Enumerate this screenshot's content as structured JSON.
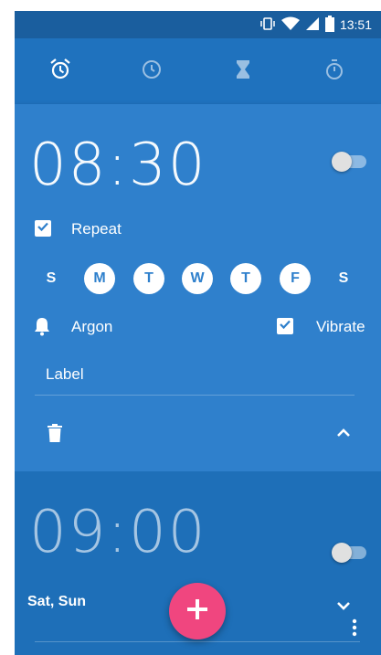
{
  "colors": {
    "primary": "#1E6FB8",
    "expanded_card": "#2F80CC",
    "accent": "#F0467F",
    "status_bar": "#1A5E9E"
  },
  "status_bar": {
    "time": "13:51",
    "icons": [
      "vibrate-icon",
      "wifi-icon",
      "signal-icon",
      "battery-icon"
    ]
  },
  "tabs": [
    {
      "name": "alarm",
      "icon": "alarm-clock-icon",
      "active": true
    },
    {
      "name": "clock",
      "icon": "clock-icon",
      "active": false
    },
    {
      "name": "timer",
      "icon": "hourglass-icon",
      "active": false
    },
    {
      "name": "stopwatch",
      "icon": "stopwatch-icon",
      "active": false
    }
  ],
  "alarms": [
    {
      "time": "08:30",
      "enabled": false,
      "expanded": true,
      "repeat_label": "Repeat",
      "repeat_checked": true,
      "days": [
        {
          "letter": "S",
          "selected": false
        },
        {
          "letter": "M",
          "selected": true
        },
        {
          "letter": "T",
          "selected": true
        },
        {
          "letter": "W",
          "selected": true
        },
        {
          "letter": "T",
          "selected": true
        },
        {
          "letter": "F",
          "selected": true
        },
        {
          "letter": "S",
          "selected": false
        }
      ],
      "ringtone": "Argon",
      "vibrate_label": "Vibrate",
      "vibrate_checked": true,
      "label_placeholder": "Label"
    },
    {
      "time": "09:00",
      "enabled": false,
      "expanded": false,
      "days_summary": "Sat, Sun"
    }
  ]
}
